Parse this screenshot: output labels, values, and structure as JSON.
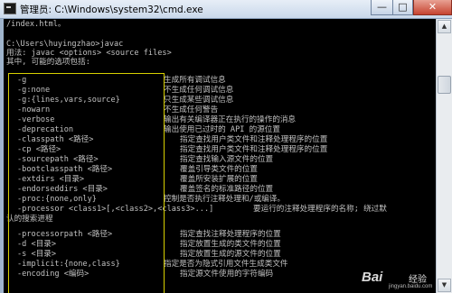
{
  "window": {
    "title": "管理员: C:\\Windows\\system32\\cmd.exe",
    "controls": {
      "minimize": "—",
      "maximize": "□",
      "close": "✕"
    }
  },
  "console": {
    "header_lines": [
      "/index.html。",
      "",
      "C:\\Users\\huyingzhao>javac",
      "用法: javac <options> <source files>",
      "其中, 可能的选项包括:"
    ],
    "options": [
      {
        "flag": "-g",
        "desc": "生成所有调试信息"
      },
      {
        "flag": "-g:none",
        "desc": "不生成任何调试信息"
      },
      {
        "flag": "-g:{lines,vars,source}",
        "desc": "只生成某些调试信息"
      },
      {
        "flag": "-nowarn",
        "desc": "不生成任何警告"
      },
      {
        "flag": "-verbose",
        "desc": "输出有关编译器正在执行的操作的消息"
      },
      {
        "flag": "-deprecation",
        "desc": "输出使用已过时的 API 的源位置"
      },
      {
        "flag": "-classpath <路径>",
        "desc": "指定查找用户类文件和注释处理程序的位置"
      },
      {
        "flag": "-cp <路径>",
        "desc": "指定查找用户类文件和注释处理程序的位置"
      },
      {
        "flag": "-sourcepath <路径>",
        "desc": "指定查找输入源文件的位置"
      },
      {
        "flag": "-bootclasspath <路径>",
        "desc": "覆盖引导类文件的位置"
      },
      {
        "flag": "-extdirs <目录>",
        "desc": "覆盖所安装扩展的位置"
      },
      {
        "flag": "-endorseddirs <目录>",
        "desc": "覆盖签名的标准路径的位置"
      },
      {
        "flag": "-proc:{none,only}",
        "desc": "控制是否执行注释处理和/或编译。"
      },
      {
        "flag": "-processor <class1>[,<class2>,<class3>...]",
        "desc": "要运行的注释处理程序的名称; 绕过默"
      },
      {
        "flag": "认的搜索进程",
        "desc": ""
      },
      {
        "flag": "-processorpath <路径>",
        "desc": "指定查找注释处理程序的位置"
      },
      {
        "flag": "-d <目录>",
        "desc": "指定放置生成的类文件的位置"
      },
      {
        "flag": "-s <目录>",
        "desc": "指定放置生成的源文件的位置"
      },
      {
        "flag": "-implicit:{none,class}",
        "desc": "指定是否为隐式引用文件生成类文件"
      },
      {
        "flag": "-encoding <编码>",
        "desc": "指定源文件使用的字符编码"
      }
    ]
  },
  "watermark": {
    "logo": "Bai",
    "sub": "经验",
    "url": "jingyan.baidu.com"
  },
  "icons": [
    "cmd-icon",
    "minimize-icon",
    "maximize-icon",
    "close-icon",
    "scroll-up-icon",
    "scroll-down-icon"
  ]
}
